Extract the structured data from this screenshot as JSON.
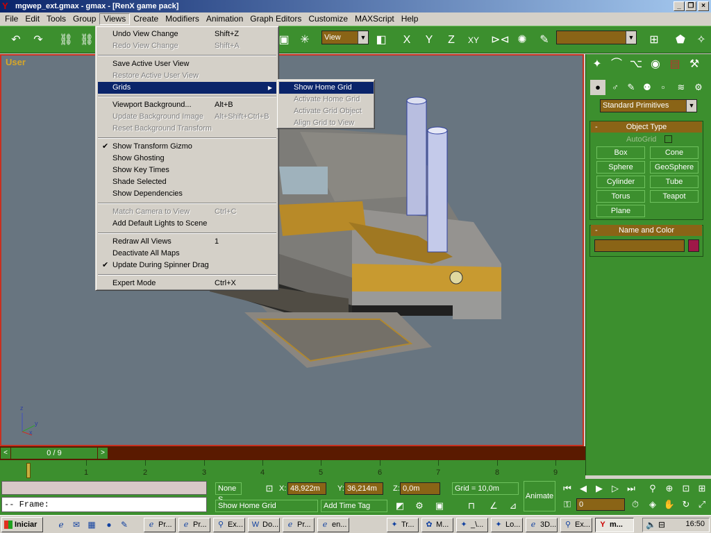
{
  "window": {
    "title": "mgwep_ext.gmax - gmax - [RenX game pack]"
  },
  "menubar": [
    "File",
    "Edit",
    "Tools",
    "Group",
    "Views",
    "Create",
    "Modifiers",
    "Animation",
    "Graph Editors",
    "Customize",
    "MAXScript",
    "Help"
  ],
  "toolbar": {
    "view_dropdown": "View",
    "selection_set": ""
  },
  "viewport": {
    "label": "User",
    "axis_x": "x",
    "axis_y": "y",
    "axis_z": "z"
  },
  "views_menu": {
    "items": [
      {
        "label": "Undo View Change",
        "shortcut": "Shift+Z",
        "enabled": true
      },
      {
        "label": "Redo View Change",
        "shortcut": "Shift+A",
        "enabled": false
      },
      {
        "label": "Save Active User View",
        "shortcut": "",
        "enabled": true
      },
      {
        "label": "Restore Active User View",
        "shortcut": "",
        "enabled": false
      },
      {
        "label": "Grids",
        "shortcut": "",
        "enabled": true,
        "submenu": true,
        "highlighted": true
      },
      {
        "label": "Viewport Background...",
        "shortcut": "Alt+B",
        "enabled": true
      },
      {
        "label": "Update Background Image",
        "shortcut": "Alt+Shift+Ctrl+B",
        "enabled": false
      },
      {
        "label": "Reset Background Transform",
        "shortcut": "",
        "enabled": false
      },
      {
        "label": "Show Transform Gizmo",
        "shortcut": "",
        "enabled": true,
        "checked": true
      },
      {
        "label": "Show Ghosting",
        "shortcut": "",
        "enabled": true
      },
      {
        "label": "Show Key Times",
        "shortcut": "",
        "enabled": true
      },
      {
        "label": "Shade Selected",
        "shortcut": "",
        "enabled": true
      },
      {
        "label": "Show Dependencies",
        "shortcut": "",
        "enabled": true
      },
      {
        "label": "Match Camera to View",
        "shortcut": "Ctrl+C",
        "enabled": false
      },
      {
        "label": "Add Default Lights to Scene",
        "shortcut": "",
        "enabled": true
      },
      {
        "label": "Redraw All Views",
        "shortcut": "1",
        "enabled": true
      },
      {
        "label": "Deactivate All Maps",
        "shortcut": "",
        "enabled": true
      },
      {
        "label": "Update During Spinner Drag",
        "shortcut": "",
        "enabled": true,
        "checked": true
      },
      {
        "label": "Expert Mode",
        "shortcut": "Ctrl+X",
        "enabled": true
      }
    ]
  },
  "grids_submenu": {
    "items": [
      {
        "label": "Show Home Grid",
        "enabled": true,
        "highlighted": true
      },
      {
        "label": "Activate Home Grid",
        "enabled": false
      },
      {
        "label": "Activate Grid Object",
        "enabled": false
      },
      {
        "label": "Align Grid to View",
        "enabled": false
      }
    ]
  },
  "command_panel": {
    "category_dropdown": "Standard Primitives",
    "object_type": {
      "header": "Object Type",
      "autogrid": "AutoGrid",
      "buttons": [
        "Box",
        "Cone",
        "Sphere",
        "GeoSphere",
        "Cylinder",
        "Tube",
        "Torus",
        "Teapot",
        "Plane"
      ]
    },
    "name_and_color": {
      "header": "Name and Color",
      "name": "",
      "color": "#9e1848"
    }
  },
  "timeline": {
    "slider": "0 / 9",
    "ticks": [
      "1",
      "2",
      "3",
      "4",
      "5",
      "6",
      "7",
      "8",
      "9"
    ]
  },
  "status": {
    "maxscript": "",
    "frame_prompt": "--  Frame:",
    "selection": "None S",
    "prompt": "Show Home Grid",
    "x_label": "X:",
    "x_value": "48,922m",
    "y_label": "Y:",
    "y_value": "36,214m",
    "z_label": "Z:",
    "z_value": "0,0m",
    "grid": "Grid = 10,0m",
    "add_time_tag": "Add Time Tag",
    "animate": "Animate",
    "frame_value": "0"
  },
  "taskbar": {
    "start": "Iniciar",
    "tasks": [
      "Pr...",
      "Pr...",
      "Ex...",
      "Do...",
      "Pr...",
      "en...",
      "Tr...",
      "M...",
      "_\\...",
      "Lo...",
      "3D...",
      "Ex...",
      "m..."
    ],
    "clock": "16:50"
  }
}
